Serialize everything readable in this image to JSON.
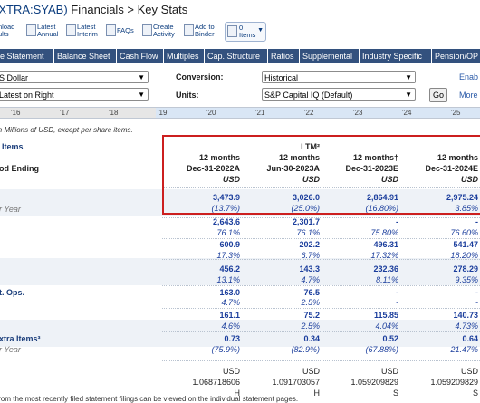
{
  "header": {
    "ticker": "(XTRA:SYAB)",
    "breadcrumb": "Financials > Key Stats"
  },
  "toolbar": {
    "download": [
      "nload",
      "ults"
    ],
    "latest_annual": [
      "Latest",
      "Annual"
    ],
    "latest_interim": [
      "Latest",
      "Interim"
    ],
    "faqs": "FAQs",
    "create_activity": [
      "Create",
      "Activity"
    ],
    "add_to_binder": [
      "Add to",
      "Binder"
    ],
    "items_count": "0",
    "items_label": "Items"
  },
  "tabs": [
    "e Statement",
    "Balance Sheet",
    "Cash Flow",
    "Multiples",
    "Cap. Structure",
    "Ratios",
    "Supplemental",
    "Industry Specific",
    "Pension/OP"
  ],
  "filters": {
    "currency": "S Dollar",
    "order": "Latest on Right",
    "conversion_label": "Conversion:",
    "conversion": "Historical",
    "units_label": "Units:",
    "units": "S&P Capital IQ (Default)",
    "go": "Go",
    "enable_link": "Enab",
    "more_link": "More"
  },
  "timeline": {
    "left_ticks": [
      "'16",
      "'17",
      "'18"
    ],
    "right_ticks": [
      "'19",
      "'20",
      "'21",
      "'22",
      "'23",
      "'24",
      "'25"
    ]
  },
  "note": "in Millions of USD, except per share items.",
  "row_labels": {
    "items": "Items",
    "period_ending": "od Ending",
    "year": "r Year",
    "cont_ops": "t. Ops.",
    "extra_items": "xtra Items³"
  },
  "columns": [
    {
      "ltm": "",
      "months": "12 months",
      "date": "Dec-31-2022A",
      "currency": "USD",
      "revenue": "3,473.9",
      "revenue_growth": "(13.7%)",
      "gross_profit": "2,643.6",
      "gross_margin": "76.1%",
      "ebitda": "600.9",
      "ebitda_margin": "17.3%",
      "ebit": "456.2",
      "ebit_margin": "13.1%",
      "earn_cont": "163.0",
      "earn_cont_margin": "4.7%",
      "net_income": "161.1",
      "net_margin": "4.6%",
      "eps": "0.73",
      "eps_growth": "(75.9%)",
      "fx_currency": "USD",
      "fx_rate": "1.068718606",
      "fx_type": "H"
    },
    {
      "ltm": "LTM²",
      "months": "12 months",
      "date": "Jun-30-2023A",
      "currency": "USD",
      "revenue": "3,026.0",
      "revenue_growth": "(25.0%)",
      "gross_profit": "2,301.7",
      "gross_margin": "76.1%",
      "ebitda": "202.2",
      "ebitda_margin": "6.7%",
      "ebit": "143.3",
      "ebit_margin": "4.7%",
      "earn_cont": "76.5",
      "earn_cont_margin": "2.5%",
      "net_income": "75.2",
      "net_margin": "2.5%",
      "eps": "0.34",
      "eps_growth": "(82.9%)",
      "fx_currency": "USD",
      "fx_rate": "1.091703057",
      "fx_type": "H"
    },
    {
      "ltm": "",
      "months": "12 months†",
      "date": "Dec-31-2023E",
      "currency": "USD",
      "revenue": "2,864.91",
      "revenue_growth": "(16.80%)",
      "gross_profit": "-",
      "gross_margin": "75.80%",
      "ebitda": "496.31",
      "ebitda_margin": "17.32%",
      "ebit": "232.36",
      "ebit_margin": "8.11%",
      "earn_cont": "-",
      "earn_cont_margin": "-",
      "net_income": "115.85",
      "net_margin": "4.04%",
      "eps": "0.52",
      "eps_growth": "(67.88%)",
      "fx_currency": "USD",
      "fx_rate": "1.059209829",
      "fx_type": "S"
    },
    {
      "ltm": "",
      "months": "12 months",
      "date": "Dec-31-2024E",
      "currency": "USD",
      "revenue": "2,975.24",
      "revenue_growth": "3.85%",
      "gross_profit": "-",
      "gross_margin": "76.60%",
      "ebitda": "541.47",
      "ebitda_margin": "18.20%",
      "ebit": "278.29",
      "ebit_margin": "9.35%",
      "earn_cont": "-",
      "earn_cont_margin": "-",
      "net_income": "140.73",
      "net_margin": "4.73%",
      "eps": "0.64",
      "eps_growth": "21.47%",
      "fx_currency": "USD",
      "fx_rate": "1.059209829",
      "fx_type": "S"
    }
  ],
  "footer_note": "from the most recently filed statement filings can be viewed on the individual statement pages.",
  "colors": {
    "tab_bg": "#33517e",
    "highlight_border": "#cc1f1f",
    "value_blue": "#1a3d9c",
    "title_blue": "#0b3c7e"
  }
}
